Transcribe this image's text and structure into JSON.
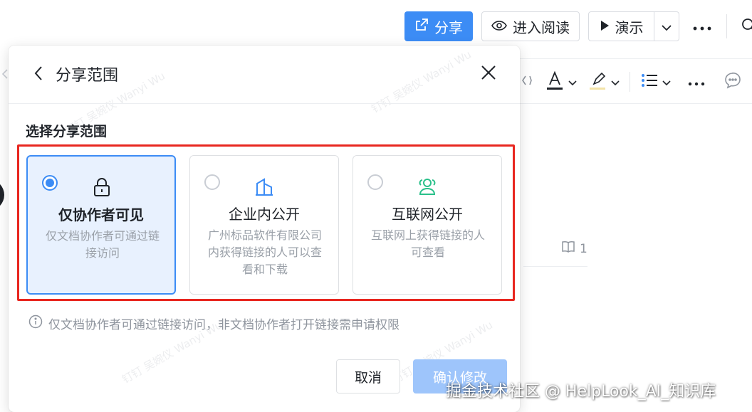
{
  "topbar": {
    "share_label": "分享",
    "read_label": "进入阅读",
    "present_label": "演示"
  },
  "editbar": {
    "page_count": "1"
  },
  "dialog": {
    "title": "分享范围",
    "section_label": "选择分享范围",
    "options": [
      {
        "title": "仅协作者可见",
        "desc": "仅文档协作者可通过链接访问",
        "icon": "lock-icon",
        "selected": true
      },
      {
        "title": "企业内公开",
        "desc": "广州标品软件有限公司内获得链接的人可以查看和下载",
        "icon": "building-icon",
        "selected": false
      },
      {
        "title": "互联网公开",
        "desc": "互联网上获得链接的人可查看",
        "icon": "users-icon",
        "selected": false
      }
    ],
    "info_text": "仅文档协作者可通过链接访问，非文档协作者打开链接需申请权限",
    "cancel_label": "取消",
    "confirm_label": "确认修改"
  },
  "watermark": {
    "text": "钉钉 吴婉仪 Wanyi Wu"
  },
  "source_mark": "掘金技术社区 @ HelpLook_AI_知识库",
  "colors": {
    "primary": "#3c8cf5",
    "primary_disabled": "#9ec5fb",
    "selected_bg": "#e8f1fe",
    "highlight_red": "#e8261f",
    "internet_icon": "#29c08a"
  }
}
